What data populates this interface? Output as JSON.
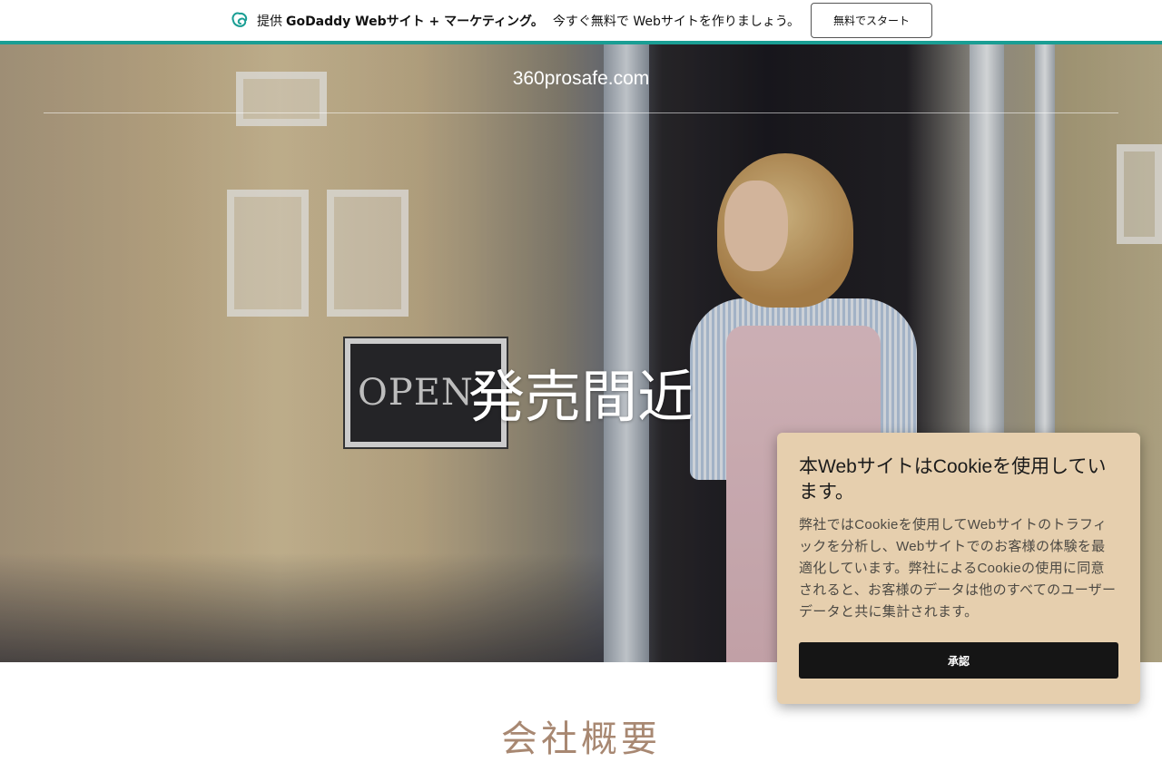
{
  "promo": {
    "provided": "提供",
    "brand": "GoDaddy Webサイト + マーケティング。",
    "tagline": "今すぐ無料で Webサイトを作りましょう。",
    "cta_label": "無料でスタート",
    "logo_icon": "godaddy-logo-icon",
    "accent_color": "#1a9e94"
  },
  "hero": {
    "site_name": "360prosafe.com",
    "headline": "発売間近",
    "sign_text": "OPEN"
  },
  "section": {
    "title": "会社概要"
  },
  "cookie": {
    "title": "本WebサイトはCookieを使用しています。",
    "body": "弊社ではCookieを使用してWebサイトのトラフィックを分析し、Webサイトでのお客様の体験を最適化しています。弊社によるCookieの使用に同意されると、お客様のデータは他のすべてのユーザーデータと共に集計されます。",
    "accept_label": "承認",
    "background_color": "#e6cfae"
  }
}
